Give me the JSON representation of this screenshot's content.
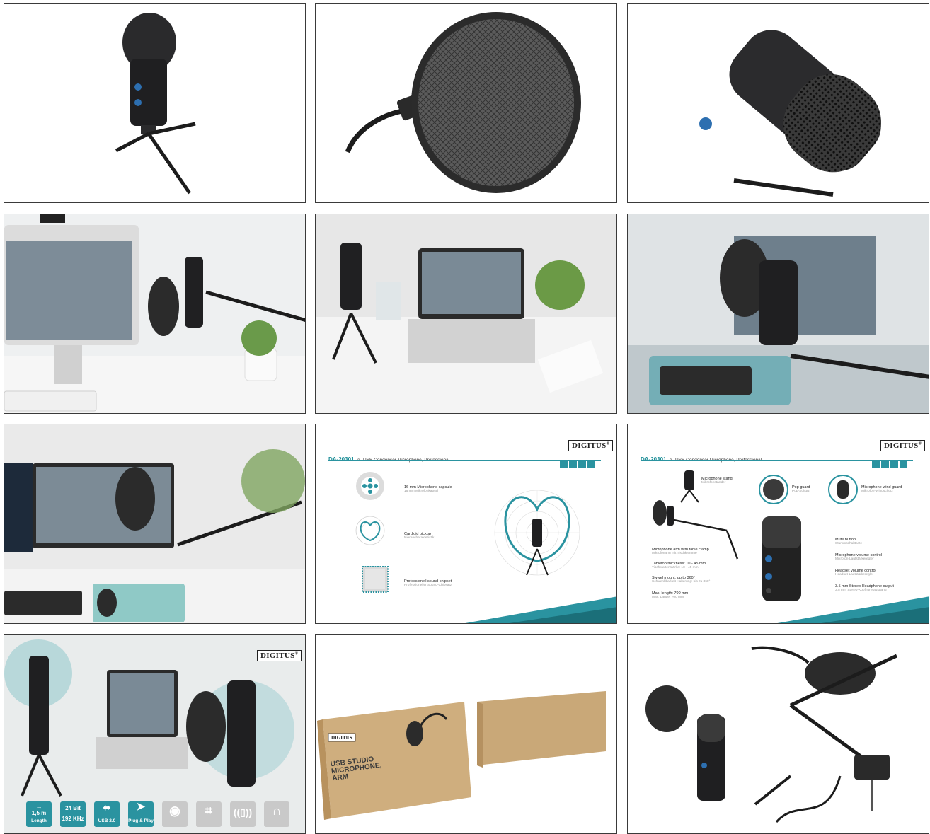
{
  "brand": "DIGITUS",
  "brand_mark": "®",
  "slide_a": {
    "code": "DA-20301",
    "separator": "//",
    "title": "USB Condenser Microphone, Professional",
    "features": [
      {
        "title": "16 mm Microphone capsule",
        "subtitle": "16 mm Mikrofonkapsel"
      },
      {
        "title": "Cardioid pickup",
        "subtitle": "Nierencharakteristik"
      },
      {
        "title": "Professionell sound-chipset",
        "subtitle": "Professioneller Sound-Chipsatz"
      }
    ]
  },
  "slide_b": {
    "code": "DA-20301",
    "separator": "//",
    "title": "USB Condenser Microphone, Professional",
    "callouts": [
      {
        "title": "Microphone stand",
        "subtitle": "Mikrofonständer"
      },
      {
        "title": "Pop guard",
        "subtitle": "Pop-Schutz"
      },
      {
        "title": "Microphone wind guard",
        "subtitle": "Mikrofon-Windschutz"
      },
      {
        "title": "Microphone arm with table clamp",
        "subtitle": "Mikrofonarm mit Tischklemme"
      },
      {
        "title": "Tabletop thickness: 10 - 45 mm",
        "subtitle": "Tischplattenstärke: 10 - 45 mm"
      },
      {
        "title": "Swivel mount: up to 360°",
        "subtitle": "Schwenkbarkeit Halterung: bis zu 360°"
      },
      {
        "title": "Max. length: 700 mm",
        "subtitle": "Max. Länge: 700 mm"
      },
      {
        "title": "Mute button",
        "subtitle": "Stummschalttaste"
      },
      {
        "title": "Microphone volume control",
        "subtitle": "Mikrofon-Lautstärkeregler"
      },
      {
        "title": "Headset volume control",
        "subtitle": "Headset-Lautstärkeregler"
      },
      {
        "title": "3.5 mm Stereo Headphone output",
        "subtitle": "3.5 mm Stereo-Kopfhörerausgang"
      }
    ]
  },
  "badges": [
    {
      "top": "1,5 m",
      "label": "Length",
      "icon": "cable-length-icon"
    },
    {
      "top": "24 Bit",
      "mid": "192 KHz",
      "icon": "audio-quality-icon"
    },
    {
      "label": "USB 2.0",
      "icon": "usb-icon"
    },
    {
      "label": "Plug & Play",
      "icon": "plug-and-play-icon"
    },
    {
      "icon": "webcam-icon"
    },
    {
      "icon": "gamepad-icon"
    },
    {
      "icon": "vibration-icon"
    },
    {
      "icon": "headphones-icon"
    }
  ],
  "box": {
    "title_lines": [
      "USB STUDIO",
      "MICROPHONE,",
      "ARM"
    ]
  },
  "colors": {
    "accent": "#2a93a0",
    "dark": "#1d1d1f",
    "box": "#c9a878"
  }
}
